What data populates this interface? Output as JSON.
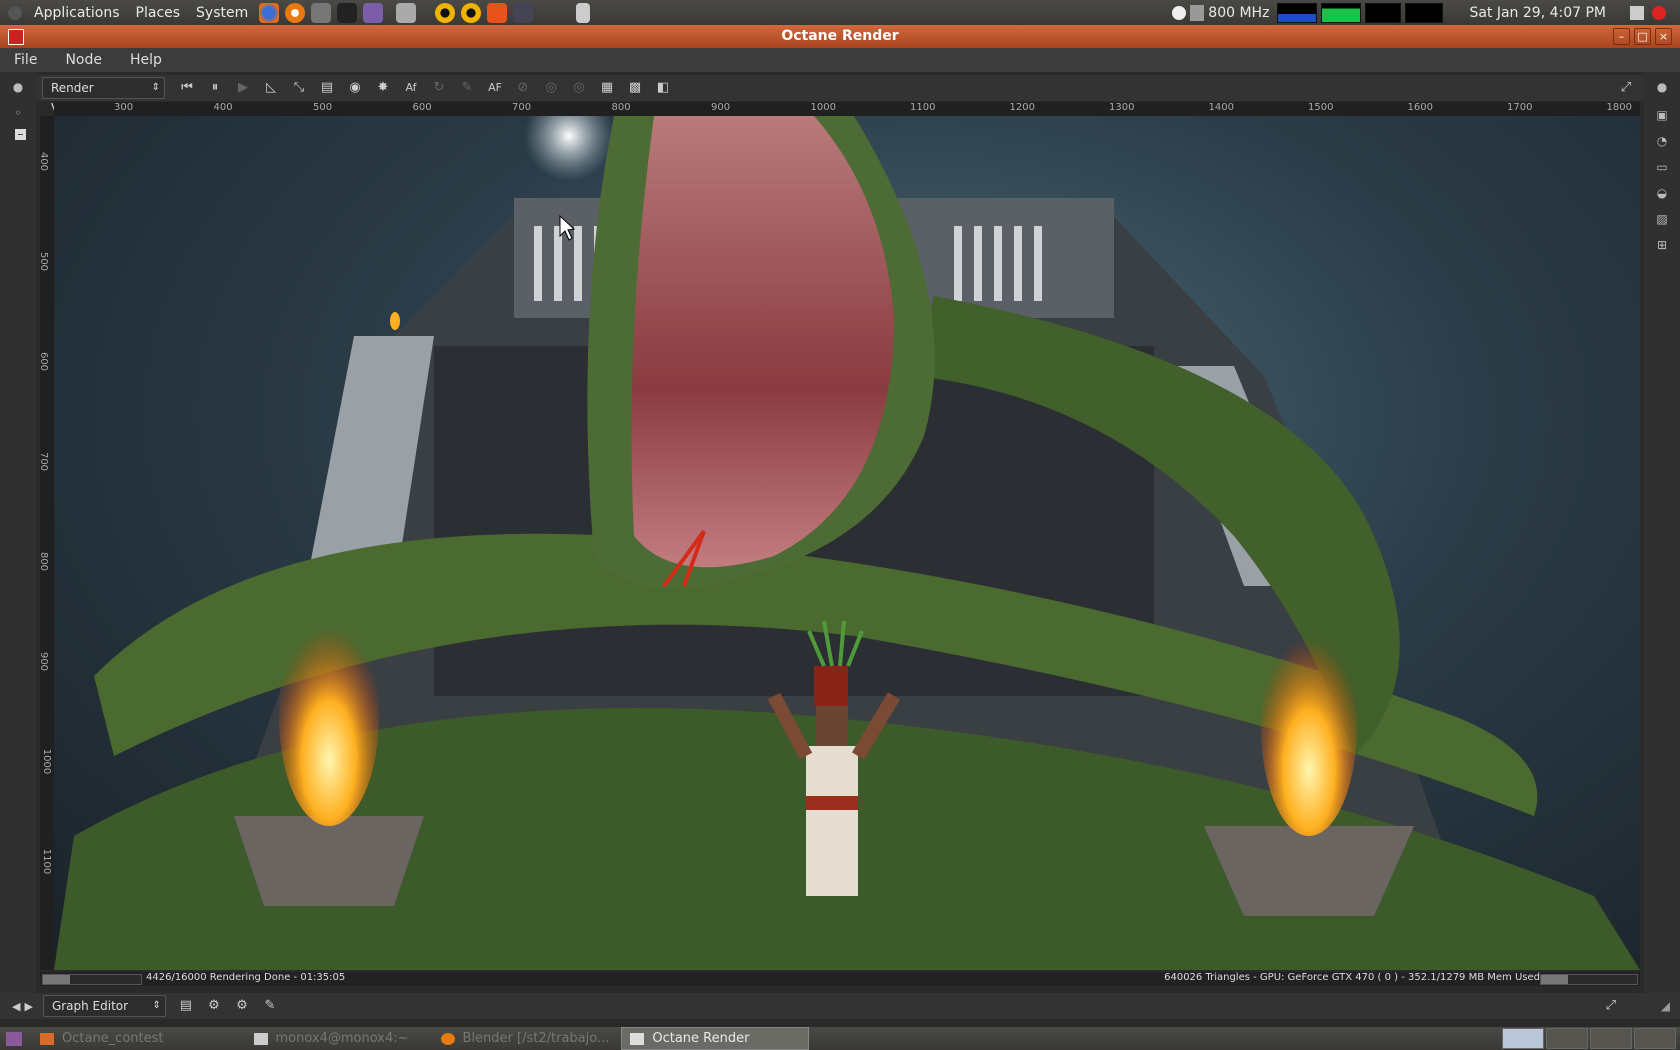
{
  "top_panel": {
    "menus": [
      "Applications",
      "Places",
      "System"
    ],
    "cpu_freq": "800 MHz",
    "clock": "Sat Jan 29,  4:07 PM"
  },
  "window": {
    "title": "Octane Render"
  },
  "menubar": {
    "items": [
      "File",
      "Node",
      "Help"
    ]
  },
  "toolbar": {
    "view_select": "Render Viewport",
    "af_label": "AF"
  },
  "ruler": {
    "x_ticks": [
      "300",
      "400",
      "500",
      "600",
      "700",
      "800",
      "900",
      "1000",
      "1100",
      "1200",
      "1300",
      "1400",
      "1500",
      "1600",
      "1700",
      "1800"
    ],
    "y_ticks": [
      "400",
      "500",
      "600",
      "700",
      "800",
      "900",
      "1000",
      "1100"
    ]
  },
  "status": {
    "left": "4426/16000 Rendering Done - 01:35:05",
    "right": "640026 Triangles - GPU: GeForce GTX 470 ( 0 ) - 352.1/1279 MB Mem Used",
    "samples_progress": 0.28,
    "mem_progress": 0.28
  },
  "graph_bar": {
    "editor_select": "Graph Editor"
  },
  "taskbar": {
    "tasks": [
      "Octane_contest",
      "monox4@monox4:~",
      "Blender [/st2/trabajo...",
      "Octane Render"
    ]
  },
  "colors": {
    "titlebar": "#c0562c",
    "panel": "#42413e"
  }
}
